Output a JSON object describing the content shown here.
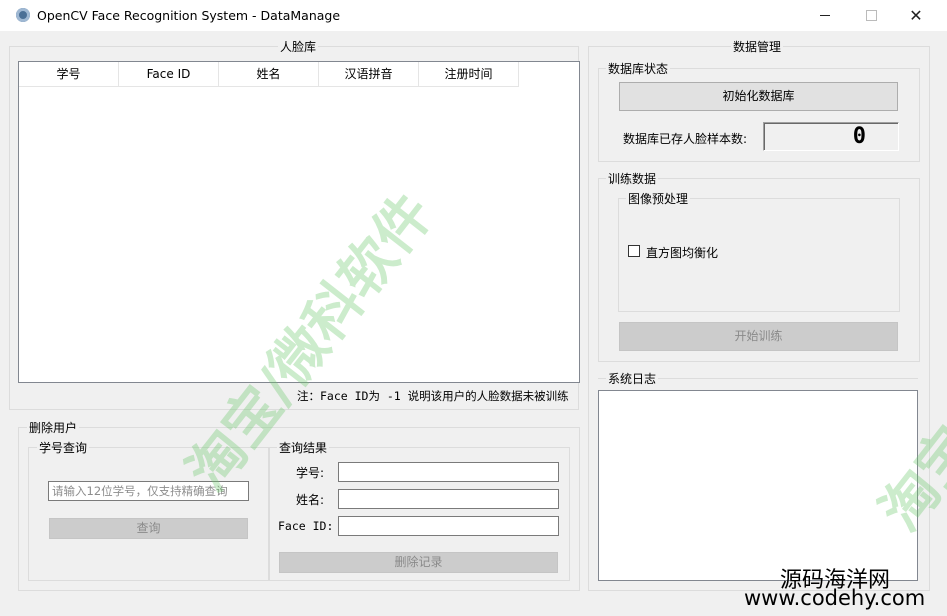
{
  "window": {
    "title": "OpenCV Face Recognition System - DataManage",
    "controls": {
      "minimize": "minimize",
      "maximize": "maximize",
      "close": "close"
    }
  },
  "face_library": {
    "title": "人脸库",
    "columns": [
      "学号",
      "Face ID",
      "姓名",
      "汉语拼音",
      "注册时间"
    ],
    "rows": [],
    "note": "注：Face ID为 -1 说明该用户的人脸数据未被训练"
  },
  "delete_user": {
    "title": "删除用户",
    "query": {
      "title": "学号查询",
      "placeholder": "请输入12位学号，仅支持精确查询",
      "button": "查询"
    },
    "result": {
      "title": "查询结果",
      "student_id_label": "学号:",
      "name_label": "姓名:",
      "face_id_label": "Face ID:",
      "student_id_value": "",
      "name_value": "",
      "face_id_value": "",
      "delete_button": "删除记录"
    }
  },
  "data_management": {
    "title": "数据管理",
    "db_status": {
      "title": "数据库状态",
      "init_button": "初始化数据库",
      "count_label": "数据库已存人脸样本数:",
      "count_value": "0"
    },
    "training": {
      "title": "训练数据",
      "preprocess": {
        "title": "图像预处理",
        "equalize_label": "直方图均衡化",
        "equalize_checked": false
      },
      "train_button": "开始训练"
    },
    "log": {
      "title": "系统日志",
      "content": ""
    }
  },
  "watermark": {
    "text": "淘宝/微科软件",
    "side_text": "淘宝",
    "site_name": "源码海洋网",
    "site_url": "www.codehy.com",
    "color": "#6ec86e"
  }
}
